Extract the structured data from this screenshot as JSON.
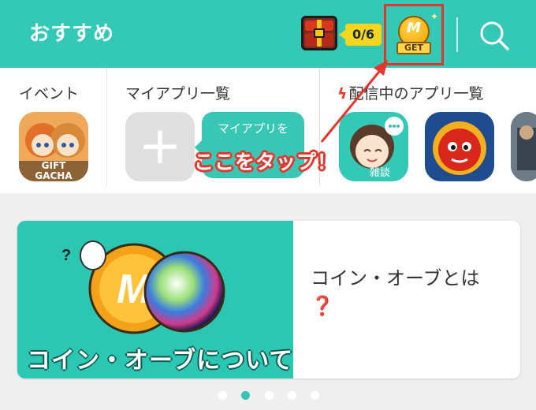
{
  "header": {
    "title": "おすすめ",
    "mission_counter": "0/6",
    "coin_get_label": "GET",
    "coin_letter": "M"
  },
  "sections": [
    {
      "title": "イベント",
      "app_label": "GIFT GACHA"
    },
    {
      "title": "マイアプリ一覧",
      "bubble_text": "マイアプリを"
    },
    {
      "title": "配信中のアプリ一覧",
      "first_app_label": "雑談"
    }
  ],
  "annotation": {
    "callout": "ここをタップ！",
    "color": "#e2362c"
  },
  "banner": {
    "image_caption": "コイン・オーブについて",
    "title": "コイン・オーブとは",
    "question_mark": "❓"
  },
  "carousel": {
    "count": 5,
    "active_index": 1
  },
  "colors": {
    "accent": "#34c9b6",
    "highlight": "#e0342c",
    "badge": "#f4d51f"
  }
}
